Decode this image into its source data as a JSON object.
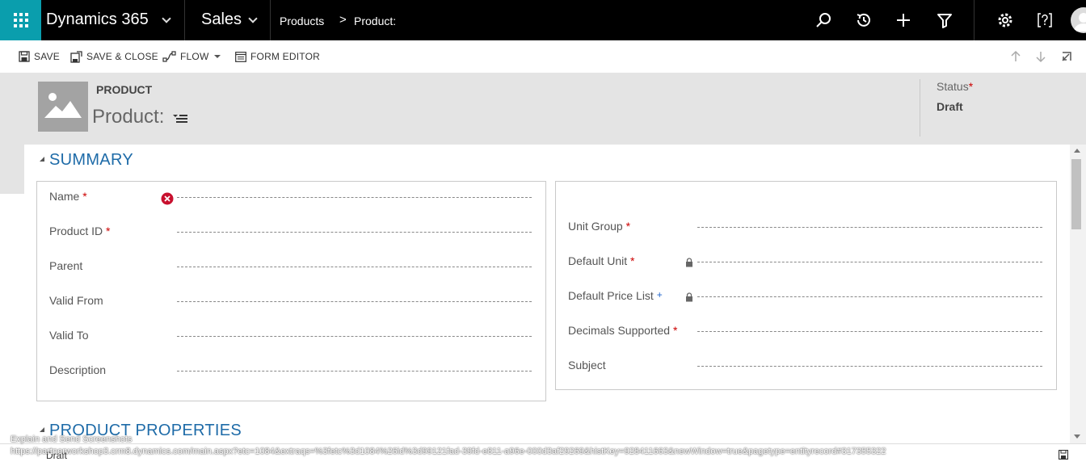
{
  "nav": {
    "app_name": "Dynamics 365",
    "area": "Sales",
    "breadcrumb_entity": "Products",
    "breadcrumb_separator": ">",
    "breadcrumb_record": "Product:",
    "icons": [
      "waffle-icon",
      "search-icon",
      "history-icon",
      "plus-icon",
      "filter-icon",
      "gear-icon",
      "help-icon",
      "user-avatar"
    ]
  },
  "commands": {
    "save": "SAVE",
    "save_close": "SAVE & CLOSE",
    "flow": "FLOW",
    "form_editor": "FORM EDITOR"
  },
  "header": {
    "entity_type": "PRODUCT",
    "record_title": "Product:",
    "status_label": "Status",
    "status_value": "Draft",
    "required_marker": "*"
  },
  "summary": {
    "title": "SUMMARY",
    "left_fields": [
      {
        "label": "Name",
        "required": true,
        "error": true
      },
      {
        "label": "Product ID",
        "required": true
      },
      {
        "label": "Parent",
        "required": false
      },
      {
        "label": "Valid From",
        "required": false
      },
      {
        "label": "Valid To",
        "required": false
      },
      {
        "label": "Description",
        "required": false
      }
    ],
    "right_fields": [
      {
        "label": "Unit Group",
        "required": true,
        "marker": "*"
      },
      {
        "label": "Default Unit",
        "required": true,
        "marker": "*",
        "locked": true
      },
      {
        "label": "Default Price List",
        "recommended": true,
        "marker": "+",
        "locked": true
      },
      {
        "label": "Decimals Supported",
        "required": true,
        "marker": "*"
      },
      {
        "label": "Subject",
        "required": false,
        "marker": ""
      }
    ]
  },
  "properties": {
    "title": "PRODUCT PROPERTIES"
  },
  "footer": {
    "status": "Draft",
    "overlay_label": "Explain and Send Screenshots",
    "overlay_url": "https://partnerworkshop3.crm8.dynamics.com/main.aspx?etc=1084&extraqs=%3fetc%3d1084%26id%3d99121fad-39fd-e811-a96e-000d3af29269&histKey=928411663&newWindow=true&pagetype=entityrecord#317355322"
  },
  "colors": {
    "topnav": "#000000",
    "waffle": "#0a9ead",
    "section_title": "#1e6ba8",
    "required": "#cc0000",
    "error": "#c8102e"
  }
}
